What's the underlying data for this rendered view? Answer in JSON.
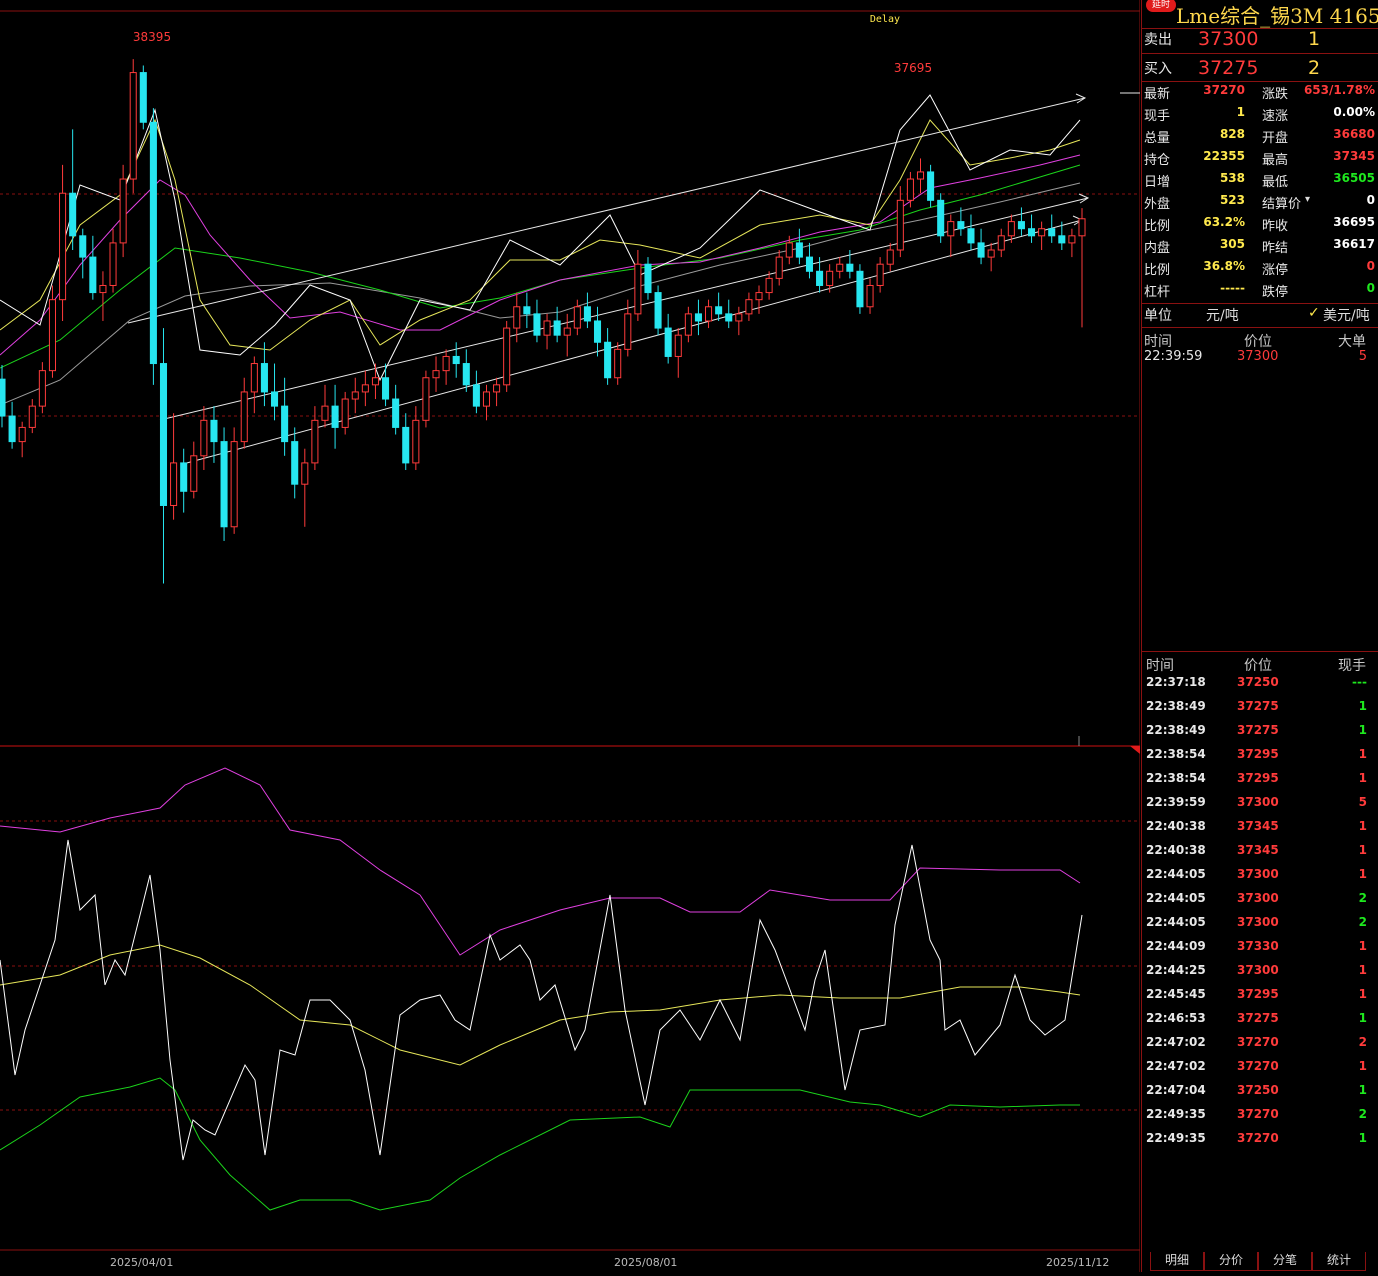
{
  "chart": {
    "delay_label": "Delay",
    "high_label": "38395",
    "high2_label": "37695",
    "x_labels": [
      "2025/04/01",
      "2025/08/01",
      "2025/11/12"
    ]
  },
  "chart_data": {
    "type": "candlestick",
    "price_range": [
      35500,
      38600
    ],
    "candles": [
      [
        36140,
        36240,
        35800,
        35880
      ],
      [
        35880,
        35980,
        35650,
        35700
      ],
      [
        35700,
        35840,
        35590,
        35800
      ],
      [
        35800,
        36000,
        35760,
        35950
      ],
      [
        35950,
        36260,
        35900,
        36200
      ],
      [
        36200,
        36800,
        36150,
        36700
      ],
      [
        36700,
        37650,
        36550,
        37450
      ],
      [
        37450,
        37900,
        37050,
        37150
      ],
      [
        37150,
        37200,
        36850,
        37000
      ],
      [
        37000,
        37150,
        36700,
        36750
      ],
      [
        36750,
        36900,
        36550,
        36800
      ],
      [
        36800,
        37200,
        36750,
        37100
      ],
      [
        37100,
        37650,
        37000,
        37550
      ],
      [
        37550,
        38395,
        37450,
        38300
      ],
      [
        38300,
        38350,
        37900,
        37950
      ],
      [
        37950,
        38050,
        36100,
        36250
      ],
      [
        36250,
        36500,
        34700,
        35250
      ],
      [
        35250,
        35900,
        35150,
        35550
      ],
      [
        35550,
        35650,
        35200,
        35350
      ],
      [
        35350,
        35700,
        35300,
        35600
      ],
      [
        35600,
        35950,
        35500,
        35850
      ],
      [
        35850,
        35950,
        35550,
        35700
      ],
      [
        35700,
        35800,
        35000,
        35100
      ],
      [
        35100,
        35800,
        35050,
        35700
      ],
      [
        35700,
        36150,
        35650,
        36050
      ],
      [
        36050,
        36300,
        35900,
        36250
      ],
      [
        36250,
        36400,
        35950,
        36050
      ],
      [
        36050,
        36250,
        35850,
        35950
      ],
      [
        35950,
        36150,
        35600,
        35700
      ],
      [
        35700,
        35800,
        35300,
        35400
      ],
      [
        35400,
        35650,
        35100,
        35550
      ],
      [
        35550,
        35950,
        35500,
        35850
      ],
      [
        35850,
        36100,
        35800,
        35950
      ],
      [
        35950,
        36100,
        35650,
        35800
      ],
      [
        35800,
        36050,
        35750,
        36000
      ],
      [
        36000,
        36150,
        35900,
        36050
      ],
      [
        36050,
        36200,
        35950,
        36100
      ],
      [
        36100,
        36250,
        36000,
        36150
      ],
      [
        36150,
        36250,
        35950,
        36000
      ],
      [
        36000,
        36100,
        35750,
        35800
      ],
      [
        35800,
        35900,
        35500,
        35550
      ],
      [
        35550,
        35950,
        35500,
        35850
      ],
      [
        35850,
        36200,
        35800,
        36150
      ],
      [
        36150,
        36300,
        36050,
        36200
      ],
      [
        36200,
        36350,
        36100,
        36300
      ],
      [
        36300,
        36400,
        36150,
        36250
      ],
      [
        36250,
        36350,
        36050,
        36100
      ],
      [
        36100,
        36200,
        35900,
        35950
      ],
      [
        35950,
        36100,
        35850,
        36050
      ],
      [
        36050,
        36150,
        35950,
        36100
      ],
      [
        36100,
        36550,
        36050,
        36500
      ],
      [
        36500,
        36750,
        36400,
        36650
      ],
      [
        36650,
        36750,
        36500,
        36600
      ],
      [
        36600,
        36700,
        36400,
        36450
      ],
      [
        36450,
        36600,
        36350,
        36550
      ],
      [
        36550,
        36650,
        36400,
        36450
      ],
      [
        36450,
        36600,
        36300,
        36500
      ],
      [
        36500,
        36700,
        36450,
        36650
      ],
      [
        36650,
        36750,
        36500,
        36550
      ],
      [
        36550,
        36650,
        36300,
        36400
      ],
      [
        36400,
        36500,
        36100,
        36150
      ],
      [
        36150,
        36400,
        36100,
        36350
      ],
      [
        36350,
        36700,
        36300,
        36600
      ],
      [
        36600,
        37050,
        36550,
        36950
      ],
      [
        36950,
        37000,
        36700,
        36750
      ],
      [
        36750,
        36800,
        36450,
        36500
      ],
      [
        36500,
        36600,
        36250,
        36300
      ],
      [
        36300,
        36500,
        36150,
        36450
      ],
      [
        36450,
        36650,
        36400,
        36600
      ],
      [
        36600,
        36700,
        36450,
        36550
      ],
      [
        36550,
        36700,
        36500,
        36650
      ],
      [
        36650,
        36750,
        36550,
        36600
      ],
      [
        36600,
        36700,
        36500,
        36550
      ],
      [
        36550,
        36650,
        36450,
        36600
      ],
      [
        36600,
        36750,
        36550,
        36700
      ],
      [
        36700,
        36800,
        36600,
        36750
      ],
      [
        36750,
        36900,
        36700,
        36850
      ],
      [
        36850,
        37050,
        36800,
        37000
      ],
      [
        37000,
        37150,
        36950,
        37100
      ],
      [
        37100,
        37200,
        36950,
        37000
      ],
      [
        37000,
        37100,
        36850,
        36900
      ],
      [
        36900,
        37000,
        36750,
        36800
      ],
      [
        36800,
        36950,
        36750,
        36900
      ],
      [
        36900,
        37000,
        36850,
        36950
      ],
      [
        36950,
        37050,
        36850,
        36900
      ],
      [
        36900,
        36950,
        36600,
        36650
      ],
      [
        36650,
        36850,
        36600,
        36800
      ],
      [
        36800,
        37000,
        36750,
        36950
      ],
      [
        36950,
        37100,
        36900,
        37050
      ],
      [
        37050,
        37500,
        37000,
        37400
      ],
      [
        37400,
        37600,
        37350,
        37550
      ],
      [
        37550,
        37695,
        37450,
        37600
      ],
      [
        37600,
        37650,
        37350,
        37400
      ],
      [
        37400,
        37450,
        37100,
        37150
      ],
      [
        37150,
        37300,
        37000,
        37250
      ],
      [
        37250,
        37350,
        37150,
        37200
      ],
      [
        37200,
        37300,
        37050,
        37100
      ],
      [
        37100,
        37200,
        36950,
        37000
      ],
      [
        37000,
        37100,
        36900,
        37050
      ],
      [
        37050,
        37200,
        37000,
        37150
      ],
      [
        37150,
        37300,
        37100,
        37250
      ],
      [
        37250,
        37350,
        37150,
        37200
      ],
      [
        37200,
        37300,
        37100,
        37150
      ],
      [
        37150,
        37250,
        37050,
        37200
      ],
      [
        37200,
        37300,
        37100,
        37150
      ],
      [
        37150,
        37250,
        37050,
        37100
      ],
      [
        37100,
        37200,
        37000,
        37150
      ],
      [
        37150,
        37345,
        36505,
        37270
      ]
    ],
    "indicator": {
      "upper_band": "magenta",
      "middle": "yellow",
      "lower_band": "green",
      "main": "white"
    }
  },
  "panel": {
    "badge": "延时",
    "title": "Lme综合_锡3M 4165",
    "ask": {
      "label": "卖出",
      "price": "37300",
      "vol": "1"
    },
    "bid": {
      "label": "买入",
      "price": "37275",
      "vol": "2"
    },
    "quote": [
      {
        "l1": "最新",
        "v1": "37270",
        "c1": "red",
        "l2": "涨跌",
        "v2": "653/1.78%",
        "c2": "red"
      },
      {
        "l1": "现手",
        "v1": "1",
        "c1": "yel",
        "l2": "速涨",
        "v2": "0.00%",
        "c2": "wht"
      },
      {
        "l1": "总量",
        "v1": "828",
        "c1": "yel",
        "l2": "开盘",
        "v2": "36680",
        "c2": "red"
      },
      {
        "l1": "持仓",
        "v1": "22355",
        "c1": "yel",
        "l2": "最高",
        "v2": "37345",
        "c2": "red"
      },
      {
        "l1": "日增",
        "v1": "538",
        "c1": "yel",
        "l2": "最低",
        "v2": "36505",
        "c2": "grn"
      },
      {
        "l1": "外盘",
        "v1": "523",
        "c1": "yel",
        "l2": "结算价",
        "v2": "0",
        "c2": "wht"
      },
      {
        "l1": "比例",
        "v1": "63.2%",
        "c1": "yel",
        "l2": "昨收",
        "v2": "36695",
        "c2": "wht"
      },
      {
        "l1": "内盘",
        "v1": "305",
        "c1": "yel",
        "l2": "昨结",
        "v2": "36617",
        "c2": "wht"
      },
      {
        "l1": "比例",
        "v1": "36.8%",
        "c1": "yel",
        "l2": "涨停",
        "v2": "0",
        "c2": "red"
      },
      {
        "l1": "杠杆",
        "v1": "-----",
        "c1": "yel",
        "l2": "跌停",
        "v2": "0",
        "c2": "grn"
      }
    ],
    "unit": {
      "label": "单位",
      "opt1": "元/吨",
      "opt2": "美元/吨",
      "check": "✓"
    },
    "big_orders": {
      "headers": [
        "时间",
        "价位",
        "大单"
      ],
      "rows": [
        {
          "time": "22:39:59",
          "price": "37300",
          "vol": "5"
        }
      ]
    },
    "ticks": {
      "headers": [
        "时间",
        "价位",
        "现手"
      ],
      "rows": [
        {
          "time": "22:37:18",
          "price": "37250",
          "vol": "---",
          "c": "grn"
        },
        {
          "time": "22:38:49",
          "price": "37275",
          "vol": "1",
          "c": "grn"
        },
        {
          "time": "22:38:49",
          "price": "37275",
          "vol": "1",
          "c": "grn"
        },
        {
          "time": "22:38:54",
          "price": "37295",
          "vol": "1",
          "c": "red"
        },
        {
          "time": "22:38:54",
          "price": "37295",
          "vol": "1",
          "c": "red"
        },
        {
          "time": "22:39:59",
          "price": "37300",
          "vol": "5",
          "c": "red"
        },
        {
          "time": "22:40:38",
          "price": "37345",
          "vol": "1",
          "c": "red"
        },
        {
          "time": "22:40:38",
          "price": "37345",
          "vol": "1",
          "c": "red"
        },
        {
          "time": "22:44:05",
          "price": "37300",
          "vol": "1",
          "c": "red"
        },
        {
          "time": "22:44:05",
          "price": "37300",
          "vol": "2",
          "c": "grn"
        },
        {
          "time": "22:44:05",
          "price": "37300",
          "vol": "2",
          "c": "grn"
        },
        {
          "time": "22:44:09",
          "price": "37330",
          "vol": "1",
          "c": "red"
        },
        {
          "time": "22:44:25",
          "price": "37300",
          "vol": "1",
          "c": "red"
        },
        {
          "time": "22:45:45",
          "price": "37295",
          "vol": "1",
          "c": "red"
        },
        {
          "time": "22:46:53",
          "price": "37275",
          "vol": "1",
          "c": "grn"
        },
        {
          "time": "22:47:02",
          "price": "37270",
          "vol": "2",
          "c": "red"
        },
        {
          "time": "22:47:02",
          "price": "37270",
          "vol": "1",
          "c": "red"
        },
        {
          "time": "22:47:04",
          "price": "37250",
          "vol": "1",
          "c": "grn"
        },
        {
          "time": "22:49:35",
          "price": "37270",
          "vol": "2",
          "c": "grn"
        },
        {
          "time": "22:49:35",
          "price": "37270",
          "vol": "1",
          "c": "grn"
        }
      ]
    },
    "tabs": [
      "明细",
      "分价",
      "分笔",
      "统计"
    ]
  },
  "colors": {
    "up": "#ff3b3b",
    "down": "#27e6f0",
    "grid": "#8a1111"
  }
}
